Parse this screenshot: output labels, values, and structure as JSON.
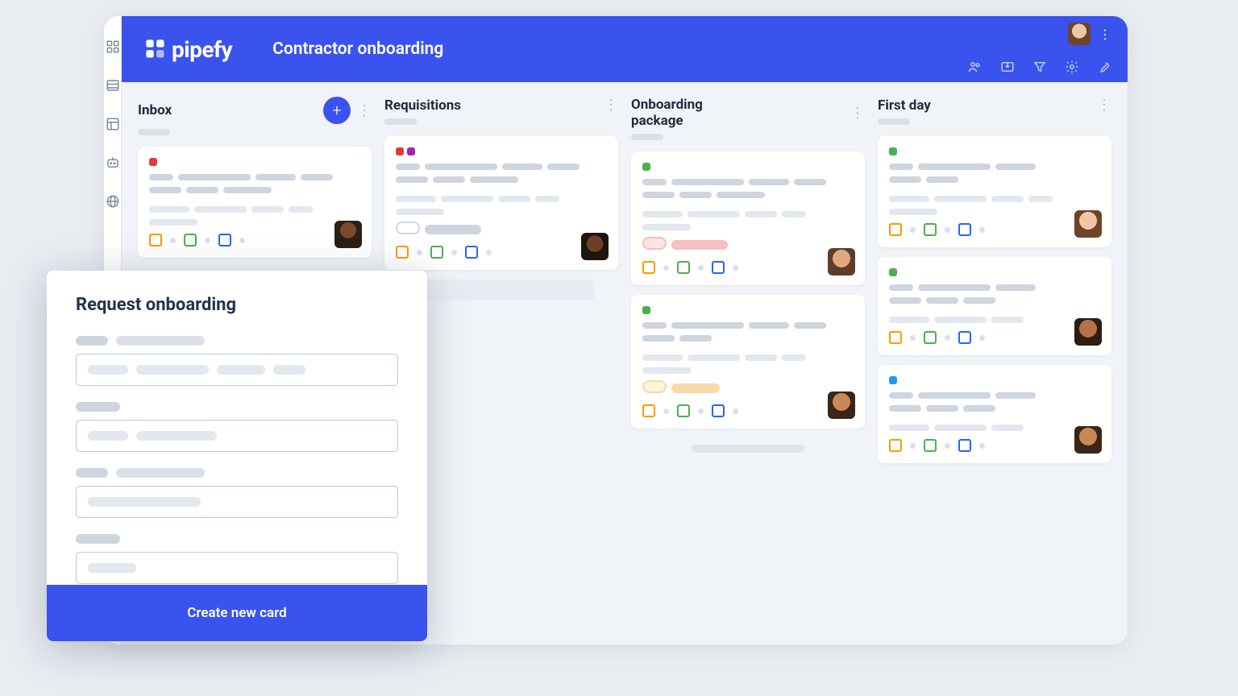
{
  "brand": "pipefy",
  "page_title": "Contractor onboarding",
  "sidebar": {
    "icons": [
      "apps",
      "database",
      "layout",
      "bot",
      "globe"
    ]
  },
  "header_tools": [
    "people",
    "inbox-in",
    "filter",
    "settings",
    "wrench"
  ],
  "columns": [
    {
      "title": "Inbox",
      "has_add": true
    },
    {
      "title": "Requisitions",
      "has_add": false
    },
    {
      "title": "Onboarding package",
      "has_add": false
    },
    {
      "title": "First day",
      "has_add": false
    }
  ],
  "modal": {
    "title": "Request onboarding",
    "submit_label": "Create new card"
  }
}
